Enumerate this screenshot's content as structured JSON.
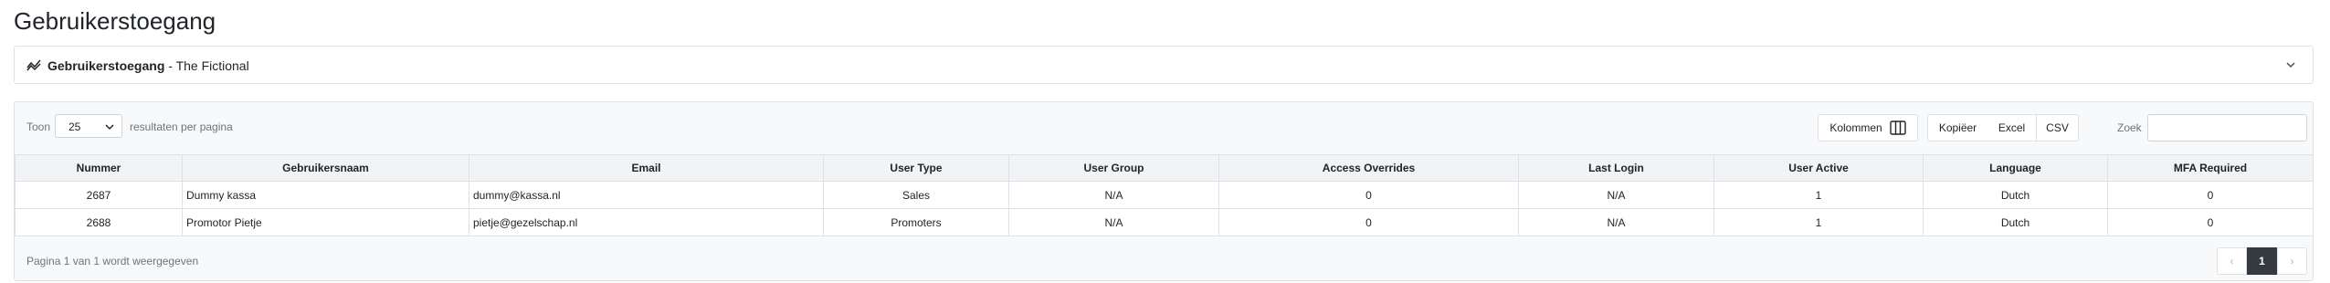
{
  "page": {
    "title": "Gebruikerstoegang"
  },
  "filter_card": {
    "title_bold": "Gebruikerstoegang",
    "title_rest": " - The Fictional"
  },
  "controls": {
    "show_label": "Toon",
    "page_length": "25",
    "per_page_label": "resultaten per pagina",
    "columns_button": "Kolommen",
    "copy_button": "Kopiëer",
    "excel_button": "Excel",
    "csv_button": "CSV",
    "search_label": "Zoek",
    "search_value": ""
  },
  "table": {
    "headers": [
      "Nummer",
      "Gebruikersnaam",
      "Email",
      "User Type",
      "User Group",
      "Access Overrides",
      "Last Login",
      "User Active",
      "Language",
      "MFA Required"
    ],
    "rows": [
      [
        "2687",
        "Dummy kassa",
        "dummy@kassa.nl",
        "Sales",
        "N/A",
        "0",
        "N/A",
        "1",
        "Dutch",
        "0"
      ],
      [
        "2688",
        "Promotor Pietje",
        "pietje@gezelschap.nl",
        "Promoters",
        "N/A",
        "0",
        "N/A",
        "1",
        "Dutch",
        "0"
      ]
    ]
  },
  "footer": {
    "info": "Pagina 1 van 1 wordt weergegeven",
    "pagination": {
      "prev": "‹",
      "current": "1",
      "next": "›"
    }
  },
  "icons": {
    "filter_icon": "chart-line-icon",
    "collapse_icon": "chevron-down-icon",
    "columns_icon": "columns-icon"
  },
  "colors": {
    "active_page": "#343a40",
    "header_bg": "#f1f3f5",
    "border": "#dee2e6"
  }
}
